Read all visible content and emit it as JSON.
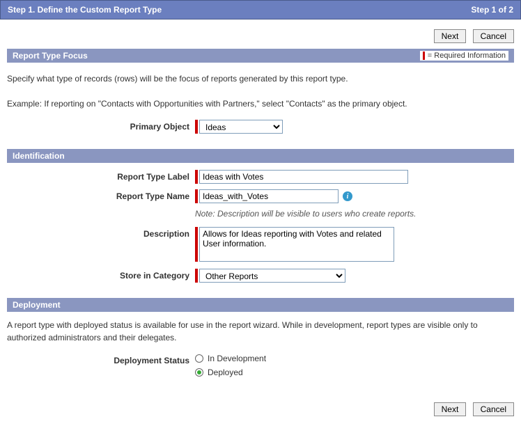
{
  "header": {
    "title": "Step 1. Define the Custom Report Type",
    "step_indicator": "Step 1 of 2"
  },
  "buttons": {
    "next": "Next",
    "cancel": "Cancel"
  },
  "sections": {
    "focus": {
      "title": "Report Type Focus",
      "required_legend": "= Required Information",
      "intro1": "Specify what type of records (rows) will be the focus of reports generated by this report type.",
      "intro2": "Example: If reporting on \"Contacts with Opportunities with Partners,\" select \"Contacts\" as the primary object.",
      "primary_object_label": "Primary Object",
      "primary_object_value": "Ideas"
    },
    "identification": {
      "title": "Identification",
      "label_label": "Report Type Label",
      "label_value": "Ideas with Votes",
      "name_label": "Report Type Name",
      "name_value": "Ideas_with_Votes",
      "note": "Note: Description will be visible to users who create reports.",
      "description_label": "Description",
      "description_value": "Allows for Ideas reporting with Votes and related User information.",
      "category_label": "Store in Category",
      "category_value": "Other Reports"
    },
    "deployment": {
      "title": "Deployment",
      "text": "A report type with deployed status is available for use in the report wizard. While in development, report types are visible only to authorized administrators and their delegates.",
      "status_label": "Deployment Status",
      "option_in_development": "In Development",
      "option_deployed": "Deployed",
      "selected": "deployed"
    }
  }
}
